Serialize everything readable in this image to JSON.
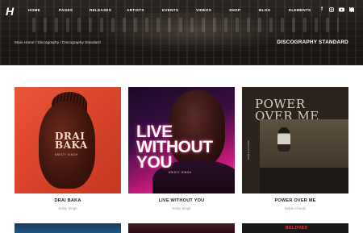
{
  "header": {
    "logo_text": "H",
    "nav": [
      "HOME",
      "PAGES",
      "RELEASES",
      "ARTISTS",
      "EVENTS",
      "VIDEOS",
      "SHOP",
      "BLOG",
      "ELEMENTS"
    ],
    "social_icons": [
      "facebook-icon",
      "instagram-icon",
      "youtube-icon",
      "bandcamp-icon"
    ],
    "breadcrumb": "Main Home / Discography / Discography Standard",
    "page_title": "DISCOGRAPHY STANDARD"
  },
  "albums": [
    {
      "title": "DRAI BAKA",
      "artist": "Kristy Singh",
      "cover_title": "DRAI\nBAKA",
      "cover_sub": "KRISTY SINGH",
      "color": "#d9442c"
    },
    {
      "title": "LIVE WITHOUT YOU",
      "artist": "Kristy Singh",
      "cover_title": "LIVE\nWITHOUT\nYOU",
      "cover_sub": "KRISTY SINGH",
      "color": "#c4187a"
    },
    {
      "title": "POWER OVER ME",
      "artist": "Noble Chords",
      "cover_title": "POWER\nOVER ME",
      "cover_sub": "NOBLE CHORDS",
      "color": "#2a241c"
    }
  ],
  "bottom_row": [
    {
      "color": "#153b5e"
    },
    {
      "color": "#4a1a24"
    },
    {
      "color": "#1a1718",
      "cover_top_text": "BELOVED"
    }
  ]
}
